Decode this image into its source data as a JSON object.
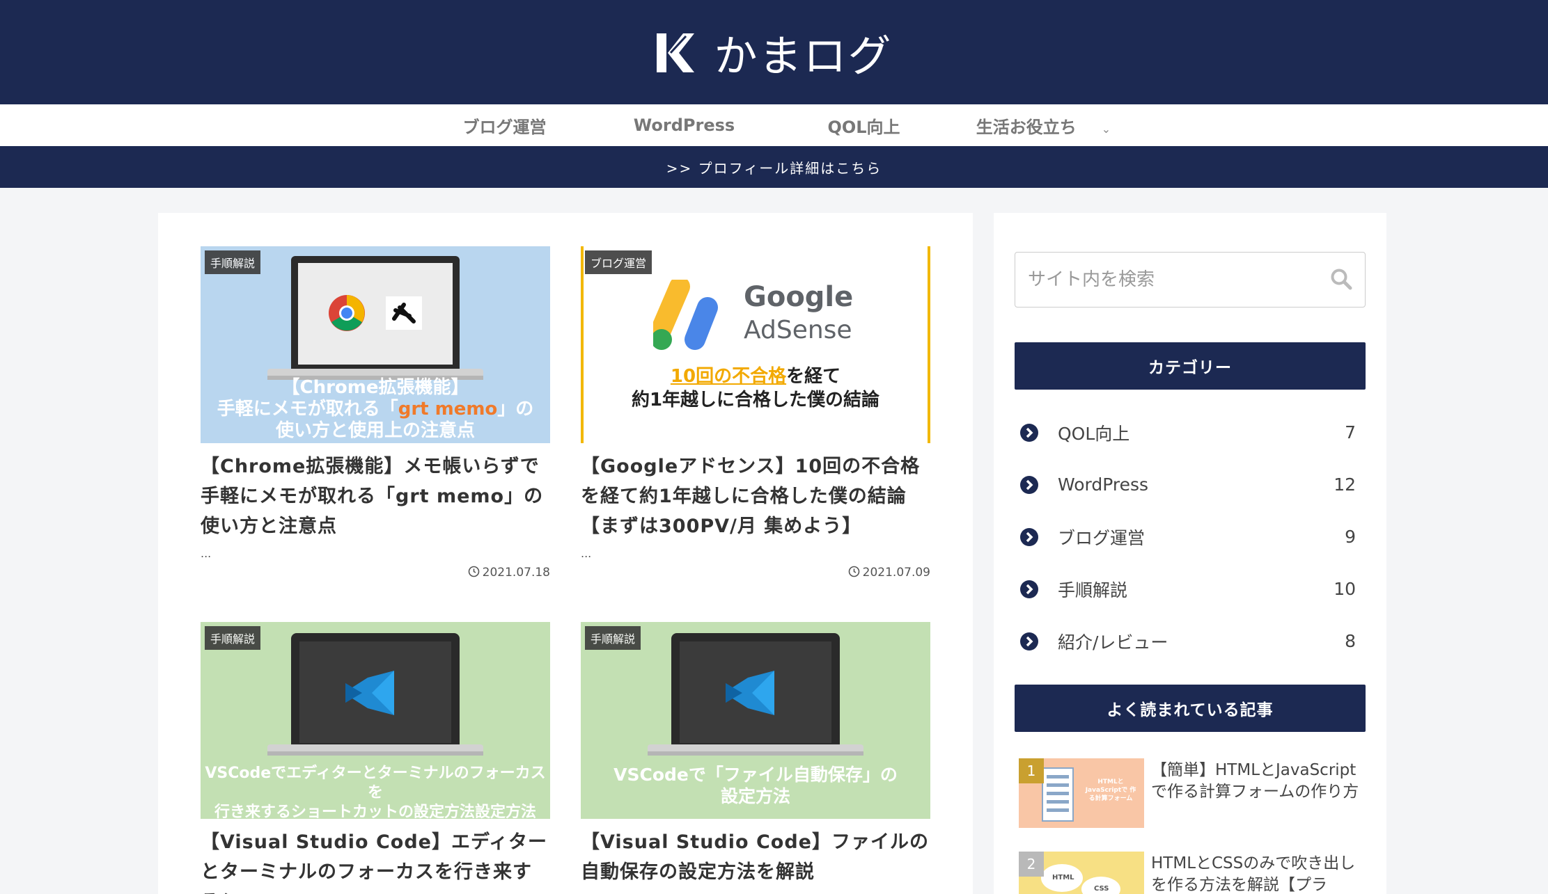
{
  "site": {
    "title": "かまログ",
    "brand_color": "#1c2952"
  },
  "nav": {
    "items": [
      "ブログ運営",
      "WordPress",
      "QOL向上",
      "生活お役立ち"
    ],
    "dropdown_icon": "chevron-down-icon"
  },
  "profile_link": ">> プロフィール詳細はこちら",
  "articles": [
    {
      "category": "手順解説",
      "thumb_caption_1": "【Chrome拡張機能】",
      "thumb_caption_2a": "手軽にメモが取れる「",
      "thumb_caption_2b": "grt memo",
      "thumb_caption_2c": "」の",
      "thumb_caption_3": "使い方と使用上の注意点",
      "title": "【Chrome拡張機能】メモ帳いらずで手軽にメモが取れる「grt memo」の使い方と注意点",
      "excerpt": "...",
      "date": "2021.07.18"
    },
    {
      "category": "ブログ運営",
      "brand_1": "Google",
      "brand_2": "AdSense",
      "thumb_caption_1a": "10回の不合格",
      "thumb_caption_1b": "を経て",
      "thumb_caption_2": "約1年越しに合格した僕の結論",
      "title": "【Googleアドセンス】10回の不合格を経て約1年越しに合格した僕の結論【まずは300PV/月 集めよう】",
      "excerpt": "...",
      "date": "2021.07.09"
    },
    {
      "category": "手順解説",
      "thumb_caption_1": "VSCodeでエディターとターミナルのフォーカスを",
      "thumb_caption_2": "行き来するショートカットの設定方法設定方法",
      "title": "【Visual Studio Code】エディターとターミナルのフォーカスを行き来するショ"
    },
    {
      "category": "手順解説",
      "thumb_caption_1": "VSCodeで「ファイル自動保存」の",
      "thumb_caption_2": "設定方法",
      "title": "【Visual Studio Code】ファイルの自動保存の設定方法を解説"
    }
  ],
  "sidebar": {
    "search_placeholder": "サイト内を検索",
    "categories_title": "カテゴリー",
    "categories": [
      {
        "name": "QOL向上",
        "count": "7"
      },
      {
        "name": "WordPress",
        "count": "12"
      },
      {
        "name": "ブログ運営",
        "count": "9"
      },
      {
        "name": "手順解説",
        "count": "10"
      },
      {
        "name": "紹介/レビュー",
        "count": "8"
      }
    ],
    "popular_title": "よく読まれている記事",
    "popular": [
      {
        "rank": "1",
        "title": "【簡単】HTMLとJavaScriptで作る計算フォームの作り方",
        "thumb_text": "HTMLと JavaScriptで 作る計算フォーム"
      },
      {
        "rank": "2",
        "title": "HTMLとCSSのみで吹き出しを作る方法を解説【プラ",
        "bubble_1": "HTML",
        "bubble_2": "CSS"
      }
    ]
  }
}
